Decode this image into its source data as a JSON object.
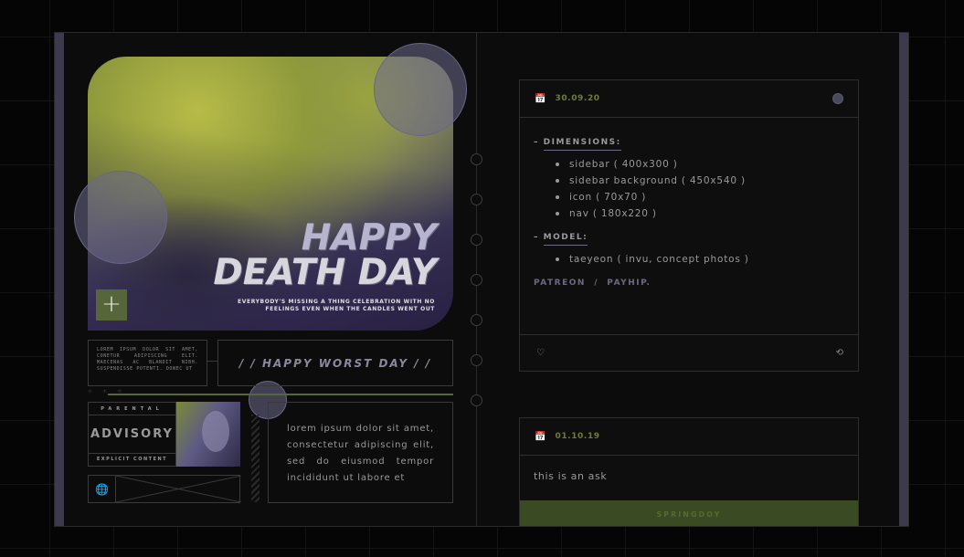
{
  "hero": {
    "title_line1": "HAPPY",
    "title_line2": "DEATH DAY",
    "subtitle": "EVERYBODY'S MISSING A THING CELEBRATION WITH NO FEELINGS EVEN WHEN THE CANDLES WENT OUT",
    "plus_icon": "+"
  },
  "widgets": {
    "small_lorem": "LOREM IPSUM DOLOR SIT AMET, CONETUR ADIPISCING ELIT. MAECENAS AC BLANDIT NIBH. SUSPENDISSE POTENTI. DONEC UT",
    "worst_day": "/ / HAPPY WORST DAY / /",
    "stars": "* * *",
    "advisory_top": "PARENTAL",
    "advisory_mid": "ADVISORY",
    "advisory_bot": "EXPLICIT CONTENT",
    "big_lorem": "lorem ipsum dolor sit amet, consectetur adipiscing elit, sed do eiusmod tempor incididunt ut labore et",
    "globe_icon": "🌐"
  },
  "posts": [
    {
      "date": "30.09.20",
      "sections": [
        {
          "title": "DIMENSIONS:",
          "items": [
            "sidebar ( 400x300 )",
            "sidebar background ( 450x540 )",
            "icon ( 70x70 )",
            "nav ( 180x220 )"
          ]
        },
        {
          "title": "MODEL:",
          "items": [
            "taeyeon ( invu, concept photos )"
          ]
        }
      ],
      "link1": "PATREON",
      "link_sep": "/",
      "link2": "PAYHIP",
      "heart_icon": "♡",
      "reblog_icon": "⟲"
    },
    {
      "date": "01.10.19",
      "ask": "this is an ask",
      "asker": "SPRINGDOY"
    }
  ],
  "colors": {
    "accent_green": "#56663a",
    "accent_purple": "#6d6a80",
    "background": "#0c0c0c"
  }
}
